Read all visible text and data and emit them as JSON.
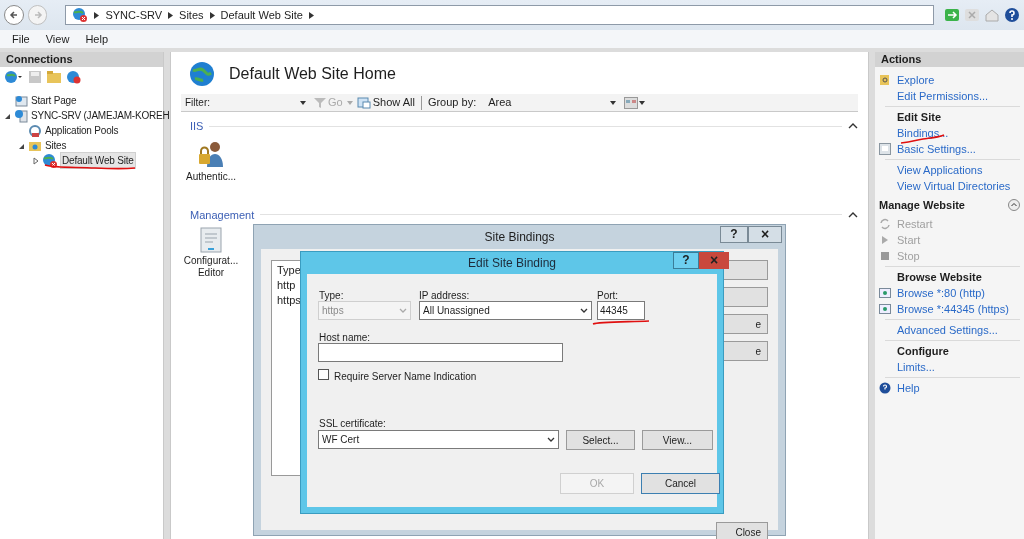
{
  "address_bar": {
    "crumbs": [
      "SYNC-SRV",
      "Sites",
      "Default Web Site"
    ]
  },
  "menu": [
    "File",
    "View",
    "Help"
  ],
  "connections": {
    "title": "Connections",
    "tree": [
      {
        "label": "Start Page",
        "selected": false
      },
      {
        "label": "SYNC-SRV (JAMEJAM-KOREH",
        "selected": false,
        "expanded": true,
        "children": [
          {
            "label": "Application Pools",
            "selected": false
          },
          {
            "label": "Sites",
            "selected": false,
            "expanded": true,
            "children": [
              {
                "label": "Default Web Site",
                "selected": true,
                "expanded": false
              }
            ]
          }
        ]
      }
    ]
  },
  "home": {
    "title": "Default Web Site Home",
    "filter_label": "Filter:",
    "go": "Go",
    "show_all": "Show All",
    "group_by_label": "Group by:",
    "group_by": "Area",
    "groups": [
      {
        "title": "IIS",
        "features": [
          {
            "label": "Authentic..."
          }
        ]
      },
      {
        "title": "Management",
        "features": [
          {
            "label": "Configurat... Editor"
          }
        ]
      }
    ]
  },
  "actions": {
    "title": "Actions",
    "items": [
      {
        "kind": "link",
        "label": "Explore"
      },
      {
        "kind": "link",
        "label": "Edit Permissions..."
      },
      {
        "kind": "heading",
        "label": "Edit Site"
      },
      {
        "kind": "link",
        "label": "Bindings..."
      },
      {
        "kind": "link",
        "label": "Basic Settings..."
      },
      {
        "kind": "link",
        "label": "View Applications"
      },
      {
        "kind": "link",
        "label": "View Virtual Directories"
      },
      {
        "kind": "section",
        "label": "Manage Website",
        "expanded": true
      },
      {
        "kind": "disabled",
        "label": "Restart"
      },
      {
        "kind": "disabled",
        "label": "Start"
      },
      {
        "kind": "disabled",
        "label": "Stop"
      },
      {
        "kind": "heading",
        "label": "Browse Website"
      },
      {
        "kind": "link",
        "label": "Browse *:80 (http)"
      },
      {
        "kind": "link",
        "label": "Browse *:44345 (https)"
      },
      {
        "kind": "link",
        "label": "Advanced Settings..."
      },
      {
        "kind": "heading",
        "label": "Configure"
      },
      {
        "kind": "link",
        "label": "Limits..."
      },
      {
        "kind": "link",
        "label": "Help"
      }
    ]
  },
  "site_bindings": {
    "title": "Site Bindings",
    "help": "?",
    "close": "×",
    "column_1": "Type",
    "rows": [
      "http",
      "https"
    ],
    "buttons": [
      "e",
      "e",
      "Close"
    ]
  },
  "edit_binding": {
    "title": "Edit Site Binding",
    "help": "?",
    "close": "×",
    "type_label": "Type:",
    "type": "https",
    "type_disabled": true,
    "ip_label": "IP address:",
    "ip": "All Unassigned",
    "port_label": "Port:",
    "port": "44345",
    "host_label": "Host name:",
    "sni_label": "Require Server Name Indication",
    "sni_checked": false,
    "ssl_label": "SSL certificate:",
    "ssl": "WF Cert",
    "select": "Select...",
    "view": "View...",
    "ok": "OK",
    "ok_disabled": true,
    "cancel": "Cancel"
  }
}
